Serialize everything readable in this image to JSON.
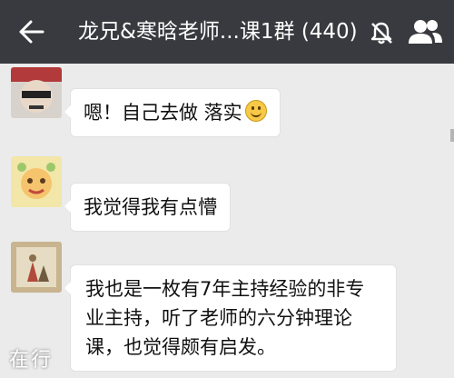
{
  "header": {
    "title": "龙兄&寒晗老师...课1群 (440)",
    "back_icon": "back-arrow-icon",
    "mute_icon": "bell-off-icon",
    "group_icon": "group-members-icon"
  },
  "messages": [
    {
      "sender": "",
      "text": "嗯！自己去做 落实",
      "emoji": "smile-emoji"
    },
    {
      "sender": "",
      "text": "我觉得我有点懵"
    },
    {
      "sender": "",
      "text_lines": [
        "我也是一枚有7年主持经验的非专",
        "业主持，听了老师的六分钟理论",
        "课，也觉得颇有启发。"
      ]
    }
  ],
  "watermark": "在行",
  "colors": {
    "header_bg": "#393a3f",
    "chat_bg": "#ebebeb",
    "bubble_bg": "#ffffff"
  }
}
